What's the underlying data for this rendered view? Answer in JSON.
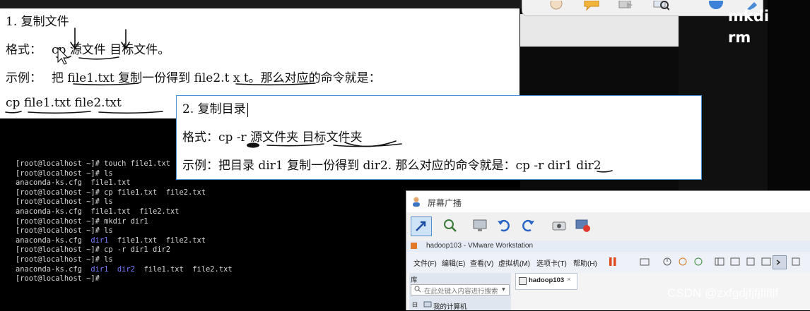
{
  "overlay_text": "mkdi\nrm",
  "panel1": {
    "heading": "1. 复制文件",
    "format_prefix": "格式：",
    "format_cmd": "cp",
    "format_src": "源文件",
    "format_dst": "目标文件。",
    "example_prefix": "示例：",
    "example_mid1": "把",
    "example_file1": "file1.txt",
    "example_mid2": "复制一份得到",
    "example_file2": "file2.t x t",
    "example_end": "。那么对应的命令就是：",
    "cmd_cp": "cp",
    "cmd_f1": "file1.txt",
    "cmd_f2": "file2.txt"
  },
  "panel2": {
    "heading": "2. 复制目录",
    "format_prefix": "格式：cp",
    "format_opt": "-r",
    "format_src": "源文件夹",
    "format_dst": "目标文件夹",
    "example_text": "示例：把目录 dir1 复制一份得到 dir2. 那么对应的命令就是：cp",
    "example_opt": "-r",
    "example_tail": "dir1 dir2"
  },
  "terminal": {
    "prompt": "[root@localhost ~]# ",
    "lines": [
      {
        "cmd": "touch file1.txt"
      },
      {
        "cmd": "ls"
      },
      {
        "out": [
          "anaconda-ks.cfg",
          "file1.txt"
        ]
      },
      {
        "cmd": "cp file1.txt  file2.txt"
      },
      {
        "cmd": "ls"
      },
      {
        "out": [
          "anaconda-ks.cfg",
          "file1.txt",
          "file2.txt"
        ]
      },
      {
        "cmd": "mkdir dir1"
      },
      {
        "cmd": "ls"
      },
      {
        "out": [
          "anaconda-ks.cfg",
          "dir1",
          "file1.txt",
          "file2.txt"
        ]
      },
      {
        "cmd": "cp -r dir1 dir2"
      },
      {
        "cmd": "ls"
      },
      {
        "out": [
          "anaconda-ks.cfg",
          "dir1",
          "dir2",
          "file1.txt",
          "file2.txt"
        ]
      },
      {
        "cmd": ""
      }
    ],
    "dir_color": "#7b7bff"
  },
  "vmware": {
    "window_title": "屏幕广播",
    "app_title": "hadoop103 - VMware Workstation",
    "menu": [
      "文件(F)",
      "编辑(E)",
      "查看(V)",
      "虚拟机(M)",
      "选项卡(T)",
      "帮助(H)"
    ],
    "library_label": "库",
    "search_placeholder": "在此处键入内容进行搜索",
    "tree_item": "我的计算机",
    "tab_label": "hadoop103"
  },
  "watermark": "CSDN @zxfgdjfjfjflfllf",
  "colors": {
    "accent": "#4a90d9",
    "pause": "#e04a1f"
  }
}
